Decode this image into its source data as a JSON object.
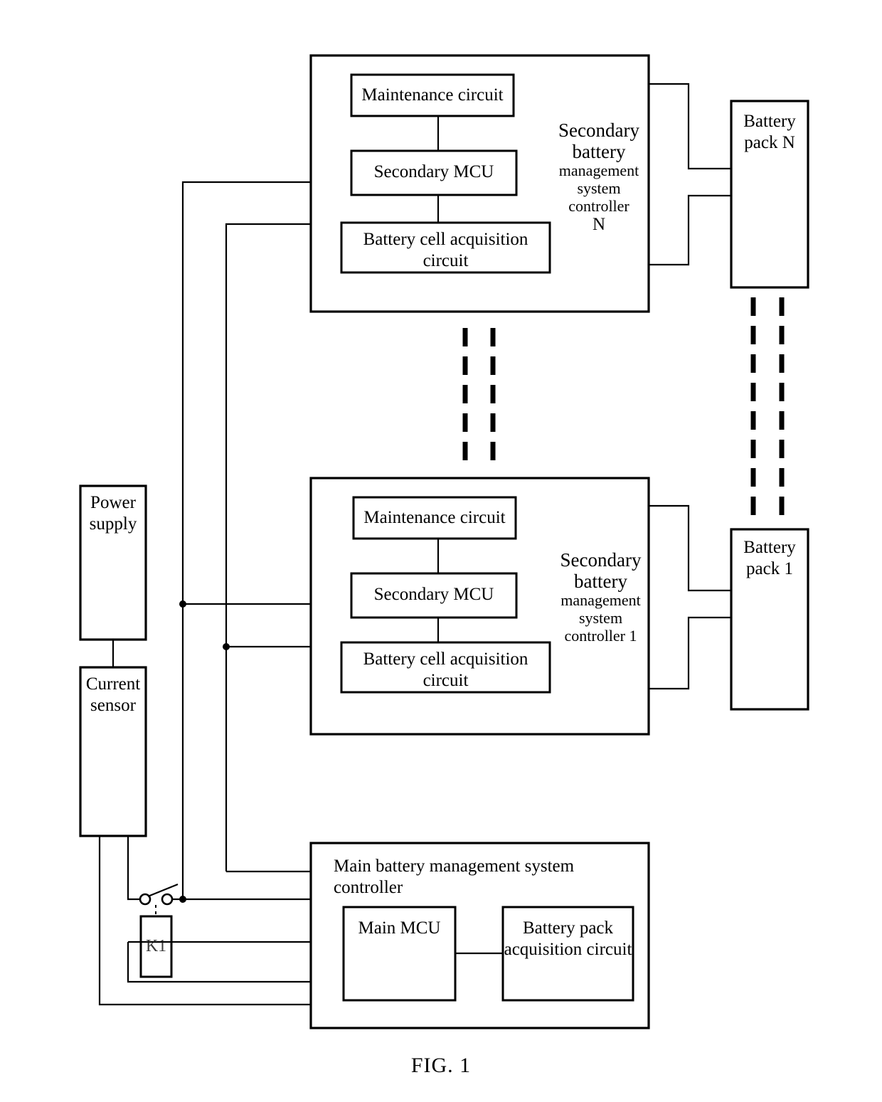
{
  "figure": {
    "caption": "FIG. 1",
    "title": "Battery management system block diagram"
  },
  "blocks": {
    "power_supply": {
      "line1": "Power",
      "line2": "supply"
    },
    "current_sensor": {
      "line1": "Current",
      "line2": "sensor"
    },
    "relay": {
      "label": "K1"
    },
    "secondary_controller_n": {
      "title_l1": "Secondary",
      "title_l2": "battery",
      "title_l3": "management",
      "title_l4": "system",
      "title_l5": "controller",
      "title_l6": "N",
      "maintenance_circuit": "Maintenance circuit",
      "secondary_mcu": "Secondary MCU",
      "cell_acquisition_l1": "Battery cell acquisition",
      "cell_acquisition_l2": "circuit"
    },
    "secondary_controller_1": {
      "title_l1": "Secondary",
      "title_l2": "battery",
      "title_l3": "management",
      "title_l4": "system",
      "title_l5": "controller 1",
      "maintenance_circuit": "Maintenance circuit",
      "secondary_mcu": "Secondary MCU",
      "cell_acquisition_l1": "Battery cell acquisition",
      "cell_acquisition_l2": "circuit"
    },
    "main_controller": {
      "title": "Main battery management system controller",
      "main_mcu": "Main MCU",
      "pack_acquisition_l1": "Battery pack",
      "pack_acquisition_l2": "acquisition circuit"
    },
    "battery_pack_n": {
      "line1": "Battery",
      "line2": "pack N"
    },
    "battery_pack_1": {
      "line1": "Battery",
      "line2": "pack 1"
    }
  },
  "ellipses": {
    "controllers_vertical": "vertical dotted continuation between secondary controller N and secondary controller 1",
    "packs_vertical": "vertical dotted continuation between battery pack N and battery pack 1"
  },
  "colors": {
    "stroke": "#000000",
    "background": "#ffffff",
    "text": "#000000"
  }
}
